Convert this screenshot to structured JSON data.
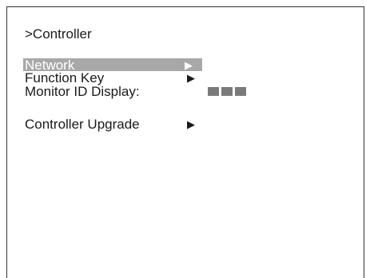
{
  "menu": {
    "title": ">Controller",
    "items": [
      {
        "label": "Network",
        "arrow": "▶",
        "selected": true
      },
      {
        "label": "Function Key",
        "arrow": "▶"
      },
      {
        "label": "Monitor ID Display:",
        "value_display": "■■■"
      },
      {
        "label": "Controller Upgrade",
        "arrow": "▶"
      }
    ]
  },
  "colors": {
    "selection_background": "#a8a8a8",
    "selection_text": "#ffffff",
    "text": "#1a1a1a",
    "value_blocks": "#7a7a7a"
  },
  "icons": {
    "submenu_arrow": "right-triangle-icon",
    "value_placeholder": "filled-blocks-icon"
  }
}
